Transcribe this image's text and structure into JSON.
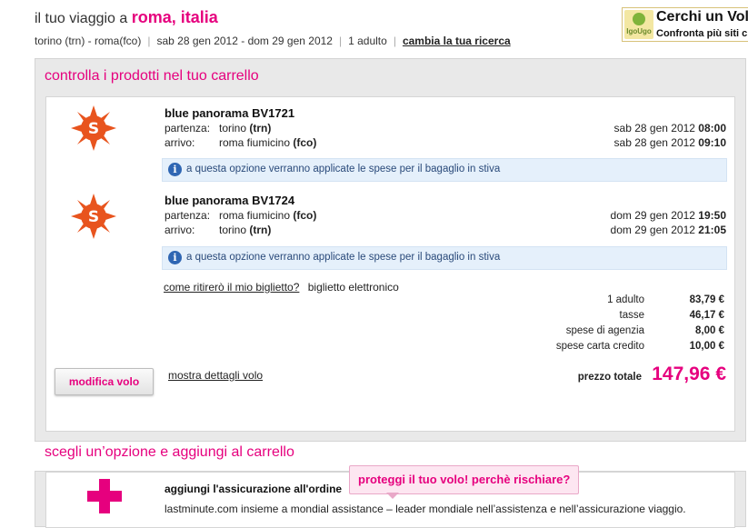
{
  "header": {
    "title_prefix": "il tuo viaggio a ",
    "destination": "roma, italia",
    "route": "torino (trn) - roma(fco)",
    "dates": "sab 28 gen 2012 - dom 29 gen 2012",
    "passengers": "1 adulto",
    "change_link": "cambia la tua ricerca"
  },
  "ad": {
    "logo_text": "IgoUgo",
    "headline": "Cerchi un Vol",
    "subline": "Confronta più siti c"
  },
  "cart": {
    "title": "controlla i prodotti nel tuo carrello",
    "flights": [
      {
        "name": "blue panorama BV1721",
        "departure_label": "partenza:",
        "departure_place": "torino ",
        "departure_code": "(trn)",
        "departure_date": "sab 28 gen 2012 ",
        "departure_time": "08:00",
        "arrival_label": "arrivo:",
        "arrival_place": "roma fiumicino ",
        "arrival_code": "(fco)",
        "arrival_date": "sab 28 gen 2012 ",
        "arrival_time": "09:10",
        "info": "a questa opzione verranno applicate le spese per il bagaglio in stiva"
      },
      {
        "name": "blue panorama BV1724",
        "departure_label": "partenza:",
        "departure_place": "roma fiumicino ",
        "departure_code": "(fco)",
        "departure_date": "dom 29 gen 2012 ",
        "departure_time": "19:50",
        "arrival_label": "arrivo:",
        "arrival_place": "torino ",
        "arrival_code": "(trn)",
        "arrival_date": "dom 29 gen 2012 ",
        "arrival_time": "21:05",
        "info": "a questa opzione verranno applicate le spese per il bagaglio in stiva"
      }
    ],
    "ticket_question": "come ritirerò il mio biglietto?",
    "ticket_answer": "biglietto elettronico",
    "price_rows": [
      {
        "label": "1 adulto",
        "value": "83,79 €"
      },
      {
        "label": "tasse",
        "value": "46,17 €"
      },
      {
        "label": "spese di agenzia",
        "value": "8,00 €"
      },
      {
        "label": "spese carta credito",
        "value": "10,00 €"
      }
    ],
    "total_label": "prezzo totale",
    "total_value": "147,96 €",
    "modify_button": "modifica volo",
    "details_link": "mostra dettagli volo"
  },
  "options": {
    "title": "scegli un’opzione e aggiungi al carrello",
    "insurance_title": "aggiungi l'assicurazione all'ordine",
    "insurance_desc": "lastminute.com insieme a mondial assistance – leader mondiale nell’assistenza e nell’assicurazione viaggio.",
    "bubble": "proteggi il tuo volo! perchè rischiare?"
  },
  "colors": {
    "accent": "#e6007e",
    "info_bg": "#e5f0fb",
    "panel_bg": "#e9e9e9",
    "logo_orange": "#e8541e"
  },
  "icons": {
    "airline_logo": "sun-logo-icon",
    "info": "info-icon",
    "insurance": "plus-cross-icon"
  }
}
